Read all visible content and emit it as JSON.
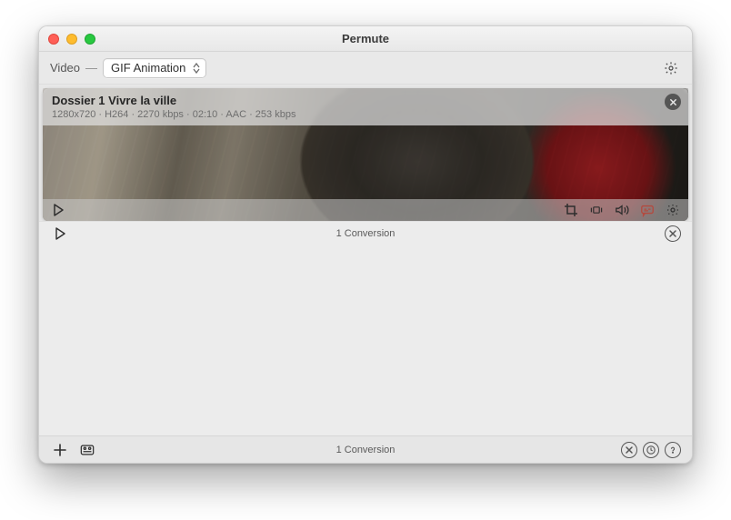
{
  "window": {
    "title": "Permute"
  },
  "toolbar": {
    "mode_label": "Video",
    "preset_selected": "GIF Animation"
  },
  "item": {
    "filename": "Dossier 1 Vivre la ville",
    "meta": "1280x720 · H264 · 2270 kbps · 02:10 · AAC · 253 kbps"
  },
  "status": {
    "text": "1 Conversion"
  },
  "bottom": {
    "text": "1 Conversion"
  }
}
